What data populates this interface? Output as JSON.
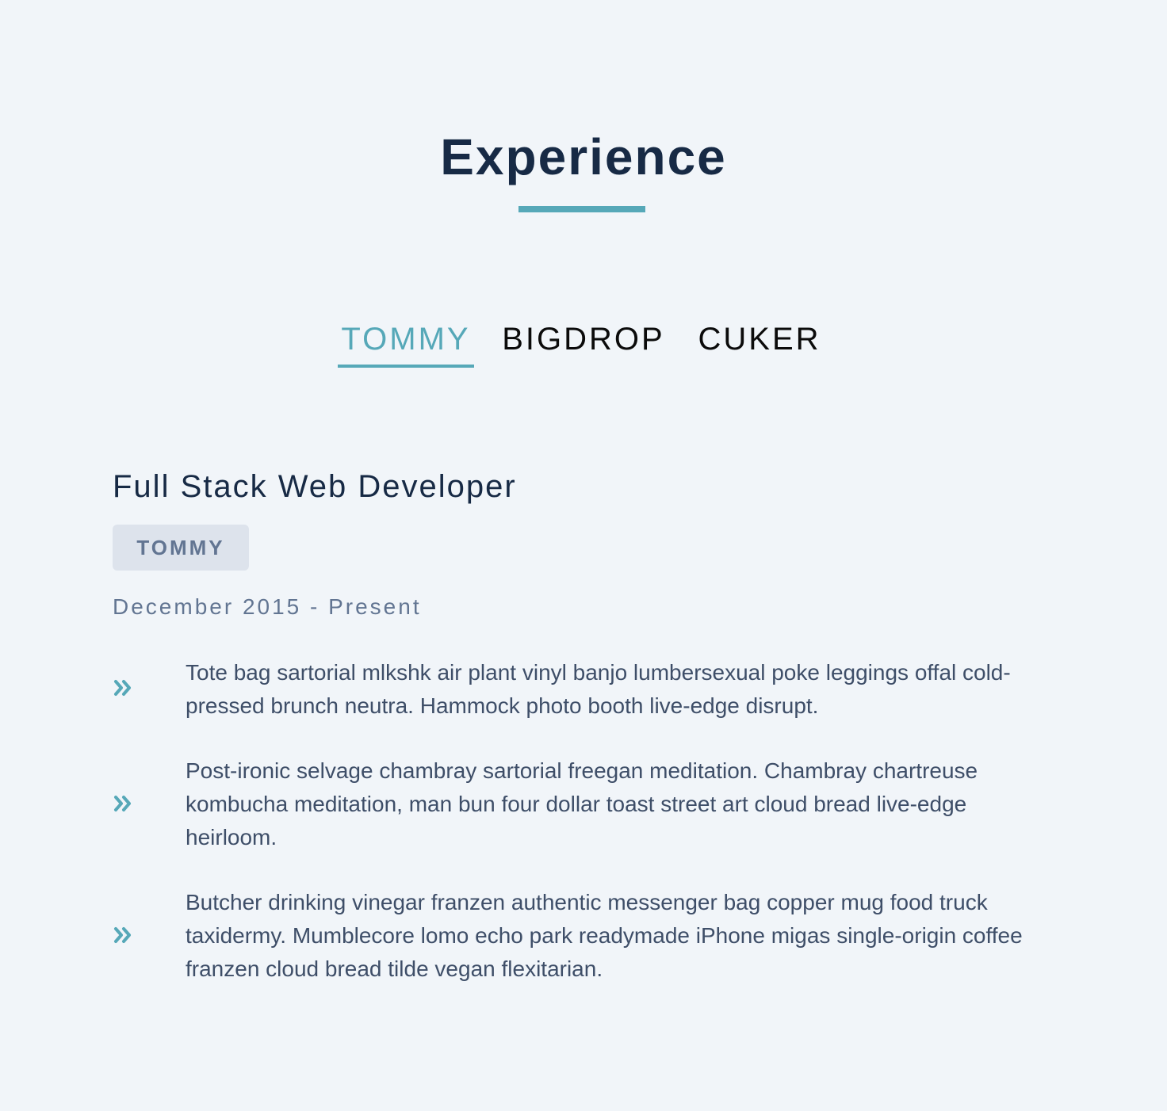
{
  "section": {
    "title": "Experience"
  },
  "tabs": [
    {
      "label": "TOMMY",
      "active": true
    },
    {
      "label": "BIGDROP",
      "active": false
    },
    {
      "label": "CUKER",
      "active": false
    }
  ],
  "job": {
    "title": "Full Stack Web Developer",
    "company": "TOMMY",
    "dates": "December 2015 - Present",
    "bullets": [
      "Tote bag sartorial mlkshk air plant vinyl banjo lumbersexual poke leggings offal cold-pressed brunch neutra. Hammock photo booth live-edge disrupt.",
      "Post-ironic selvage chambray sartorial freegan meditation. Chambray chartreuse kombucha meditation, man bun four dollar toast street art cloud bread live-edge heirloom.",
      "Butcher drinking vinegar franzen authentic messenger bag copper mug food truck taxidermy. Mumblecore lomo echo park readymade iPhone migas single-origin coffee franzen cloud bread tilde vegan flexitarian."
    ],
    "bullet_icon": "double-chevron-right-icon"
  },
  "colors": {
    "accent": "#56a8b8",
    "heading": "#172a45",
    "muted": "#627592",
    "body_text": "#3e4e68",
    "badge_bg": "#dde3ec",
    "background": "#f1f5f9"
  }
}
